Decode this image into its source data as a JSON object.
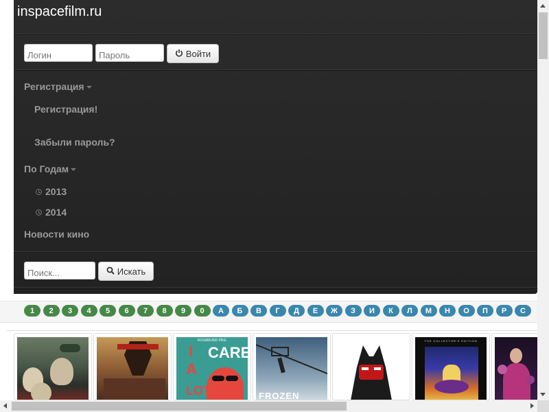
{
  "brand": "inspacefilm.ru",
  "login": {
    "login_placeholder": "Логин",
    "password_placeholder": "Пароль",
    "submit_label": "Войти"
  },
  "menu": {
    "registration": {
      "label": "Регистрация",
      "items": [
        "Регистрация!",
        "Забыли пароль?"
      ]
    },
    "by_years": {
      "label": "По Годам",
      "items": [
        "2013",
        "2014"
      ]
    },
    "news": "Новости кино"
  },
  "search": {
    "placeholder": "Поиск...",
    "button_label": "Искать"
  },
  "alphabet": {
    "digits": [
      "1",
      "2",
      "3",
      "4",
      "5",
      "6",
      "7",
      "8",
      "9",
      "0"
    ],
    "letters": [
      "А",
      "Б",
      "В",
      "Г",
      "Д",
      "Е",
      "Ж",
      "З",
      "И",
      "К",
      "Л",
      "М",
      "Н",
      "О",
      "П",
      "Р",
      "С"
    ]
  },
  "posters": [
    {
      "title_text": ""
    },
    {
      "title_text": ""
    },
    {
      "title_text": "I CARE A LOT",
      "top_text": "ROSAMUND PIKE"
    },
    {
      "title_text": "FROZEN"
    },
    {
      "title_text": ""
    },
    {
      "title_text": "THE COLLECTOR'S EDITION"
    },
    {
      "title_text": ""
    }
  ],
  "colors": {
    "navbar": "#222222",
    "badge_digit": "#468847",
    "badge_letter": "#3a87ad"
  }
}
